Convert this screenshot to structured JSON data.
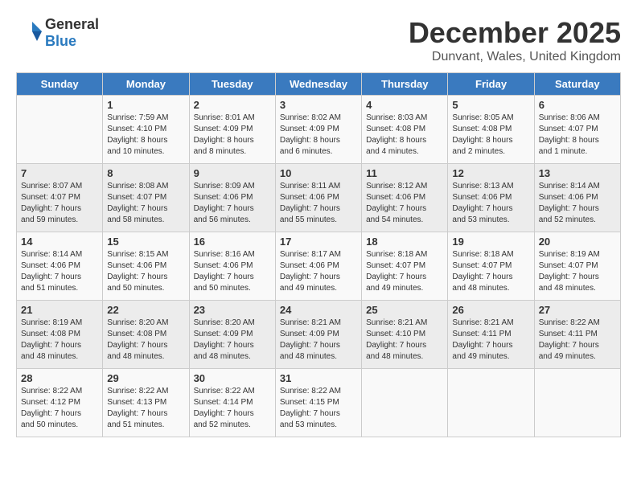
{
  "logo": {
    "text_general": "General",
    "text_blue": "Blue"
  },
  "header": {
    "month": "December 2025",
    "location": "Dunvant, Wales, United Kingdom"
  },
  "days_of_week": [
    "Sunday",
    "Monday",
    "Tuesday",
    "Wednesday",
    "Thursday",
    "Friday",
    "Saturday"
  ],
  "weeks": [
    {
      "days": [
        {
          "number": "",
          "content": ""
        },
        {
          "number": "1",
          "content": "Sunrise: 7:59 AM\nSunset: 4:10 PM\nDaylight: 8 hours\nand 10 minutes."
        },
        {
          "number": "2",
          "content": "Sunrise: 8:01 AM\nSunset: 4:09 PM\nDaylight: 8 hours\nand 8 minutes."
        },
        {
          "number": "3",
          "content": "Sunrise: 8:02 AM\nSunset: 4:09 PM\nDaylight: 8 hours\nand 6 minutes."
        },
        {
          "number": "4",
          "content": "Sunrise: 8:03 AM\nSunset: 4:08 PM\nDaylight: 8 hours\nand 4 minutes."
        },
        {
          "number": "5",
          "content": "Sunrise: 8:05 AM\nSunset: 4:08 PM\nDaylight: 8 hours\nand 2 minutes."
        },
        {
          "number": "6",
          "content": "Sunrise: 8:06 AM\nSunset: 4:07 PM\nDaylight: 8 hours\nand 1 minute."
        }
      ]
    },
    {
      "days": [
        {
          "number": "7",
          "content": "Sunrise: 8:07 AM\nSunset: 4:07 PM\nDaylight: 7 hours\nand 59 minutes."
        },
        {
          "number": "8",
          "content": "Sunrise: 8:08 AM\nSunset: 4:07 PM\nDaylight: 7 hours\nand 58 minutes."
        },
        {
          "number": "9",
          "content": "Sunrise: 8:09 AM\nSunset: 4:06 PM\nDaylight: 7 hours\nand 56 minutes."
        },
        {
          "number": "10",
          "content": "Sunrise: 8:11 AM\nSunset: 4:06 PM\nDaylight: 7 hours\nand 55 minutes."
        },
        {
          "number": "11",
          "content": "Sunrise: 8:12 AM\nSunset: 4:06 PM\nDaylight: 7 hours\nand 54 minutes."
        },
        {
          "number": "12",
          "content": "Sunrise: 8:13 AM\nSunset: 4:06 PM\nDaylight: 7 hours\nand 53 minutes."
        },
        {
          "number": "13",
          "content": "Sunrise: 8:14 AM\nSunset: 4:06 PM\nDaylight: 7 hours\nand 52 minutes."
        }
      ]
    },
    {
      "days": [
        {
          "number": "14",
          "content": "Sunrise: 8:14 AM\nSunset: 4:06 PM\nDaylight: 7 hours\nand 51 minutes."
        },
        {
          "number": "15",
          "content": "Sunrise: 8:15 AM\nSunset: 4:06 PM\nDaylight: 7 hours\nand 50 minutes."
        },
        {
          "number": "16",
          "content": "Sunrise: 8:16 AM\nSunset: 4:06 PM\nDaylight: 7 hours\nand 50 minutes."
        },
        {
          "number": "17",
          "content": "Sunrise: 8:17 AM\nSunset: 4:06 PM\nDaylight: 7 hours\nand 49 minutes."
        },
        {
          "number": "18",
          "content": "Sunrise: 8:18 AM\nSunset: 4:07 PM\nDaylight: 7 hours\nand 49 minutes."
        },
        {
          "number": "19",
          "content": "Sunrise: 8:18 AM\nSunset: 4:07 PM\nDaylight: 7 hours\nand 48 minutes."
        },
        {
          "number": "20",
          "content": "Sunrise: 8:19 AM\nSunset: 4:07 PM\nDaylight: 7 hours\nand 48 minutes."
        }
      ]
    },
    {
      "days": [
        {
          "number": "21",
          "content": "Sunrise: 8:19 AM\nSunset: 4:08 PM\nDaylight: 7 hours\nand 48 minutes."
        },
        {
          "number": "22",
          "content": "Sunrise: 8:20 AM\nSunset: 4:08 PM\nDaylight: 7 hours\nand 48 minutes."
        },
        {
          "number": "23",
          "content": "Sunrise: 8:20 AM\nSunset: 4:09 PM\nDaylight: 7 hours\nand 48 minutes."
        },
        {
          "number": "24",
          "content": "Sunrise: 8:21 AM\nSunset: 4:09 PM\nDaylight: 7 hours\nand 48 minutes."
        },
        {
          "number": "25",
          "content": "Sunrise: 8:21 AM\nSunset: 4:10 PM\nDaylight: 7 hours\nand 48 minutes."
        },
        {
          "number": "26",
          "content": "Sunrise: 8:21 AM\nSunset: 4:11 PM\nDaylight: 7 hours\nand 49 minutes."
        },
        {
          "number": "27",
          "content": "Sunrise: 8:22 AM\nSunset: 4:11 PM\nDaylight: 7 hours\nand 49 minutes."
        }
      ]
    },
    {
      "days": [
        {
          "number": "28",
          "content": "Sunrise: 8:22 AM\nSunset: 4:12 PM\nDaylight: 7 hours\nand 50 minutes."
        },
        {
          "number": "29",
          "content": "Sunrise: 8:22 AM\nSunset: 4:13 PM\nDaylight: 7 hours\nand 51 minutes."
        },
        {
          "number": "30",
          "content": "Sunrise: 8:22 AM\nSunset: 4:14 PM\nDaylight: 7 hours\nand 52 minutes."
        },
        {
          "number": "31",
          "content": "Sunrise: 8:22 AM\nSunset: 4:15 PM\nDaylight: 7 hours\nand 53 minutes."
        },
        {
          "number": "",
          "content": ""
        },
        {
          "number": "",
          "content": ""
        },
        {
          "number": "",
          "content": ""
        }
      ]
    }
  ]
}
